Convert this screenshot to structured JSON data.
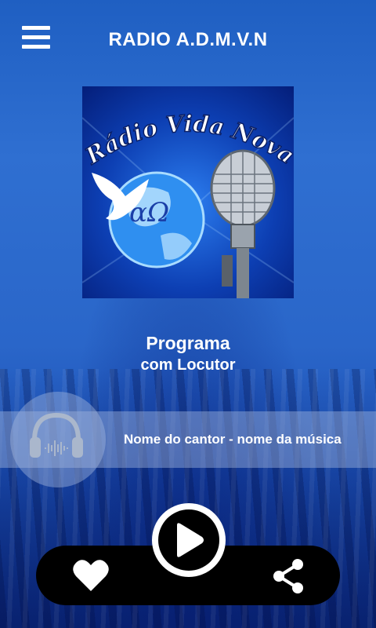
{
  "header": {
    "title": "RADIO A.D.M.V.N",
    "menu_icon": "hamburger-icon"
  },
  "cover": {
    "logo_text": "Rádio Vida Nova",
    "symbol_text": "αΩ"
  },
  "program": {
    "name": "Programa",
    "announcer": "com Locutor"
  },
  "now_playing": {
    "track": "Nome do cantor - nome da música",
    "icon": "headphones-icon"
  },
  "controls": {
    "like_icon": "heart-icon",
    "play_icon": "play-icon",
    "share_icon": "share-icon"
  }
}
